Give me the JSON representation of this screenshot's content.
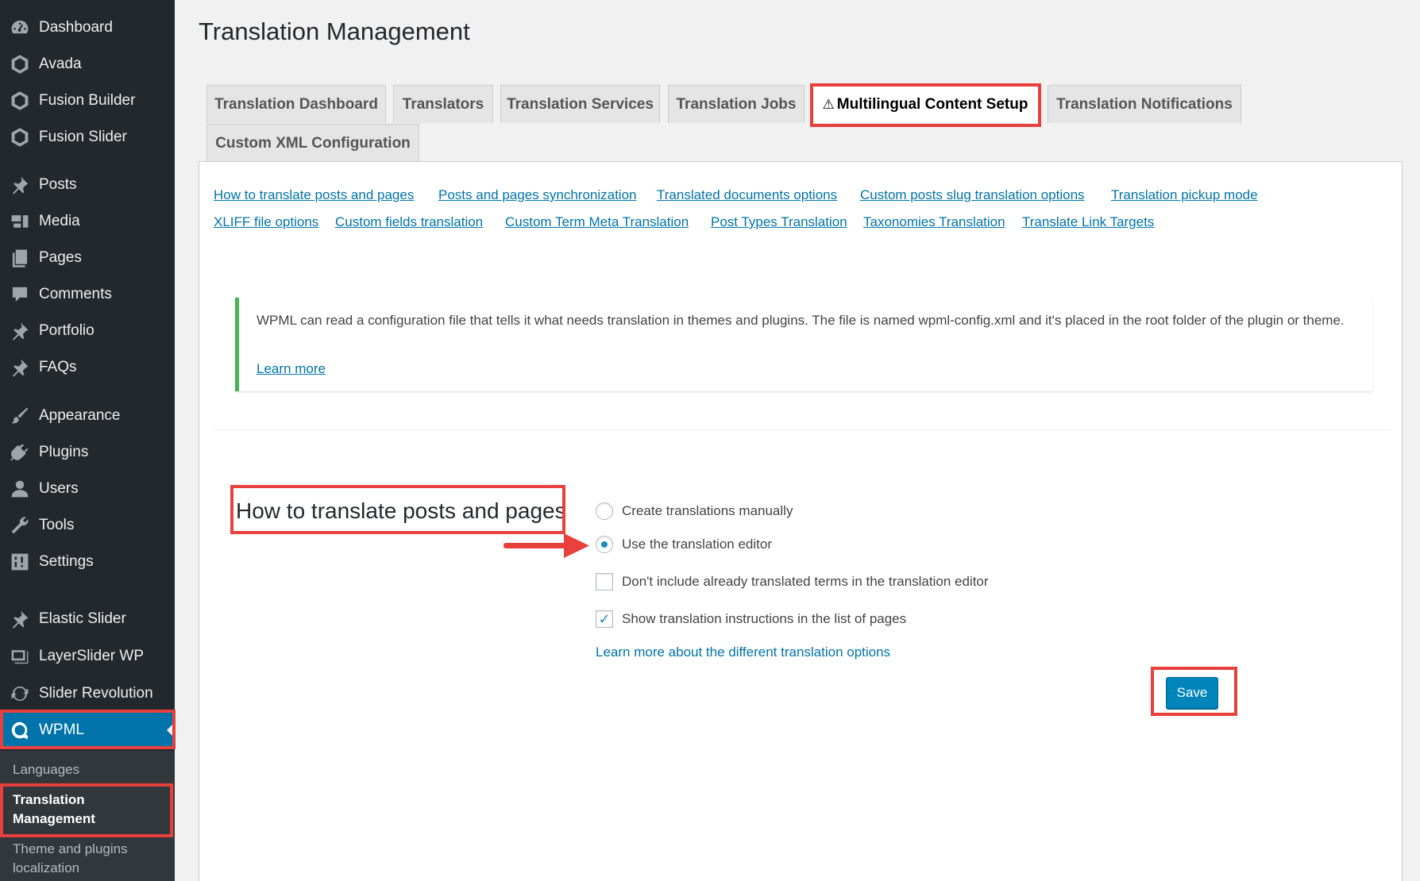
{
  "sidebar": {
    "items": [
      {
        "label": "Dashboard",
        "icon": "dashboard-icon"
      },
      {
        "label": "Avada",
        "icon": "avada-icon"
      },
      {
        "label": "Fusion Builder",
        "icon": "fusion-builder-icon"
      },
      {
        "label": "Fusion Slider",
        "icon": "fusion-slider-icon"
      },
      {
        "label": "Posts",
        "icon": "pin-icon"
      },
      {
        "label": "Media",
        "icon": "media-icon"
      },
      {
        "label": "Pages",
        "icon": "pages-icon"
      },
      {
        "label": "Comments",
        "icon": "comment-icon"
      },
      {
        "label": "Portfolio",
        "icon": "pin-icon"
      },
      {
        "label": "FAQs",
        "icon": "pin-icon"
      },
      {
        "label": "Appearance",
        "icon": "brush-icon"
      },
      {
        "label": "Plugins",
        "icon": "plugin-icon"
      },
      {
        "label": "Users",
        "icon": "user-icon"
      },
      {
        "label": "Tools",
        "icon": "wrench-icon"
      },
      {
        "label": "Settings",
        "icon": "settings-icon"
      },
      {
        "label": "Elastic Slider",
        "icon": "pin-icon"
      },
      {
        "label": "LayerSlider WP",
        "icon": "layers-icon"
      },
      {
        "label": "Slider Revolution",
        "icon": "refresh-icon"
      },
      {
        "label": "WPML",
        "icon": "wpml-icon"
      }
    ],
    "submenu": {
      "languages": "Languages",
      "translation_management": "Translation Management",
      "theme_plugins": "Theme and plugins localization"
    }
  },
  "page": {
    "title": "Translation Management"
  },
  "tabs": [
    {
      "label": "Translation Dashboard"
    },
    {
      "label": "Translators"
    },
    {
      "label": "Translation Services"
    },
    {
      "label": "Translation Jobs"
    },
    {
      "label": "Multilingual Content Setup",
      "icon": "warning-icon"
    },
    {
      "label": "Translation Notifications"
    },
    {
      "label": "Custom XML Configuration"
    }
  ],
  "quick_links": [
    "How to translate posts and pages",
    "Posts and pages synchronization",
    "Translated documents options",
    "Custom posts slug translation options",
    "Translation pickup mode",
    "XLIFF file options",
    "Custom fields translation",
    "Custom Term Meta Translation",
    "Post Types Translation",
    "Taxonomies Translation",
    "Translate Link Targets"
  ],
  "notice": {
    "text": "WPML can read a configuration file that tells it what needs translation in themes and plugins. The file is named wpml-config.xml and it's placed in the root folder of the plugin or theme.",
    "link": "Learn more"
  },
  "section": {
    "title": "How to translate posts and pages",
    "options": [
      {
        "label": "Create translations manually",
        "type": "radio",
        "checked": false
      },
      {
        "label": "Use the translation editor",
        "type": "radio",
        "checked": true
      },
      {
        "label": "Don't include already translated terms in the translation editor",
        "type": "checkbox",
        "checked": false
      },
      {
        "label": "Show translation instructions in the list of pages",
        "type": "checkbox",
        "checked": true
      }
    ],
    "learn_more": "Learn more about the different translation options",
    "save_label": "Save"
  },
  "colors": {
    "sidebar_bg": "#23282d",
    "active_menu": "#0073aa",
    "link": "#0073aa",
    "highlight": "#e8403c",
    "notice_border": "#46b450"
  }
}
